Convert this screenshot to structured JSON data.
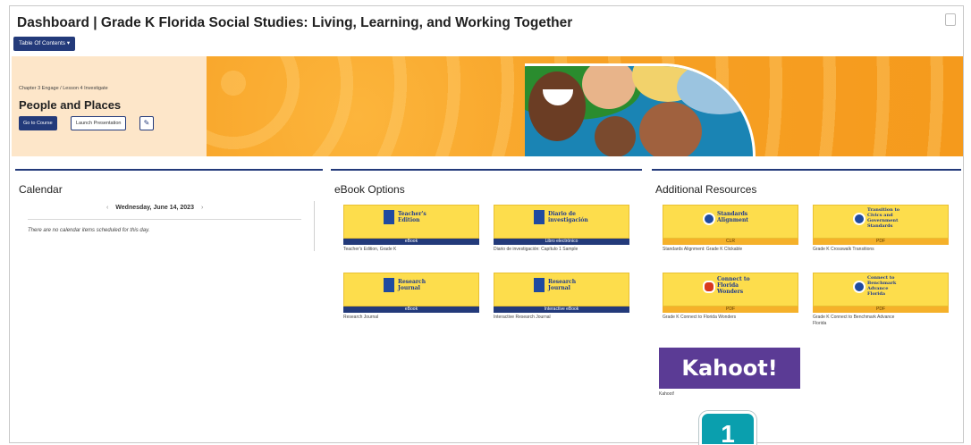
{
  "header": {
    "title": "Dashboard | Grade K Florida Social Studies: Living, Learning, and Working Together",
    "toc_label": "Table Of Contents ▾"
  },
  "hero": {
    "breadcrumb": "Chapter 3 Engage  /  Lesson 4 Investigate",
    "title": "People and Places",
    "go_label": "Go to Course",
    "launch_label": "Launch Presentation",
    "edit_icon": "✎"
  },
  "calendar": {
    "heading": "Calendar",
    "prev": "‹",
    "date": "Wednesday, June 14, 2023",
    "next": "›",
    "empty_text": "There are no calendar items scheduled for this day."
  },
  "ebooks": {
    "heading": "eBook Options",
    "items": [
      {
        "title": "Teacher's\nEdition",
        "bar": "eBook",
        "caption": "Teacher's Edition, Grade K"
      },
      {
        "title": "Diario de\ninvestigación",
        "bar": "Libro electrónico",
        "caption": "Diario de investigación: Capítulo 1 Sample"
      },
      {
        "title": "Research\nJournal",
        "bar": "eBook",
        "caption": "Research Journal"
      },
      {
        "title": "Research\nJournal",
        "bar": "Interactive eBook",
        "caption": "Interactive Research Journal"
      }
    ]
  },
  "resources": {
    "heading": "Additional Resources",
    "items": [
      {
        "title": "Standards\nAlignment",
        "bar": "CLR",
        "caption": "Standards Alignment: Grade K Clickable"
      },
      {
        "title": "Transition to\nCivics and\nGovernment\nStandards",
        "bar": "PDF",
        "caption": "Grade K Crosswalk Transitions"
      },
      {
        "title": "Connect to\nFlorida\nWonders",
        "bar": "PDF",
        "caption": "Grade K Connect to Florida Wonders"
      },
      {
        "title": "Connect to\nBenchmark\nAdvance\nFlorida",
        "bar": "PDF",
        "caption": "Grade K Connect to Benchmark Advance\nFlorida"
      }
    ],
    "kahoot_logo": "Kahoot!",
    "kahoot_caption": "Kahoot!"
  },
  "step_badge": "1",
  "colors": {
    "accent": "#233a7a",
    "banner": "#f59a1c",
    "tile": "#fddd4c",
    "kahoot": "#5b3b95",
    "badge": "#0a9fae"
  }
}
